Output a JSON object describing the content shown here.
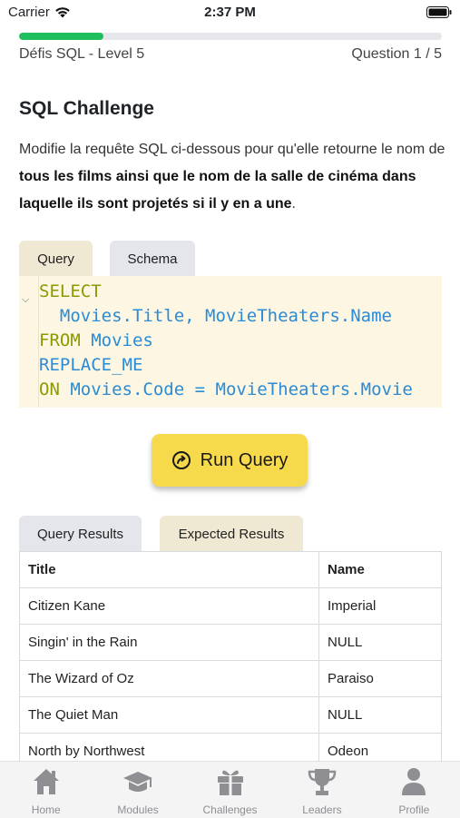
{
  "status_bar": {
    "carrier": "Carrier",
    "time": "2:37 PM"
  },
  "progress": {
    "fraction": 0.2
  },
  "header": {
    "level": "Défis SQL - Level 5",
    "question": "Question 1 / 5"
  },
  "challenge": {
    "title": "SQL Challenge",
    "desc_prefix": "Modifie la requête SQL ci-dessous pour qu'elle retourne le nom de ",
    "desc_bold": "tous les films ainsi que le nom de la salle de cinéma dans laquelle ils sont projetés si il y en a une",
    "desc_suffix": "."
  },
  "editor_tabs": {
    "query": "Query",
    "schema": "Schema"
  },
  "code": {
    "line1_kw": "SELECT",
    "line2_a": "  Movies.Title",
    "line2_sep": ", ",
    "line2_b": "MovieTheaters.Name",
    "line3_kw": "FROM",
    "line3_id": " Movies",
    "line4_id": "REPLACE_ME",
    "line5_kw": "ON",
    "line5_a": " Movies.Code",
    "line5_op": " = ",
    "line5_b": "MovieTheaters.Movie"
  },
  "run_button": {
    "label": "Run Query"
  },
  "result_tabs": {
    "results": "Query Results",
    "expected": "Expected Results"
  },
  "table": {
    "columns": [
      "Title",
      "Name"
    ],
    "rows": [
      [
        "Citizen Kane",
        "Imperial"
      ],
      [
        "Singin' in the Rain",
        "NULL"
      ],
      [
        "The Wizard of Oz",
        "Paraiso"
      ],
      [
        "The Quiet Man",
        "NULL"
      ],
      [
        "North by Northwest",
        "Odeon"
      ]
    ]
  },
  "tab_bar": {
    "items": [
      {
        "label": "Home",
        "icon": "home-icon"
      },
      {
        "label": "Modules",
        "icon": "graduation-cap-icon"
      },
      {
        "label": "Challenges",
        "icon": "gift-icon"
      },
      {
        "label": "Leaders",
        "icon": "trophy-icon"
      },
      {
        "label": "Profile",
        "icon": "user-icon"
      }
    ]
  },
  "colors": {
    "accent_green": "#1fbf5e",
    "button_yellow": "#f7d94c",
    "editor_bg": "#fdf6e3",
    "keyword": "#8a9a00",
    "identifier": "#2a8bd6"
  }
}
